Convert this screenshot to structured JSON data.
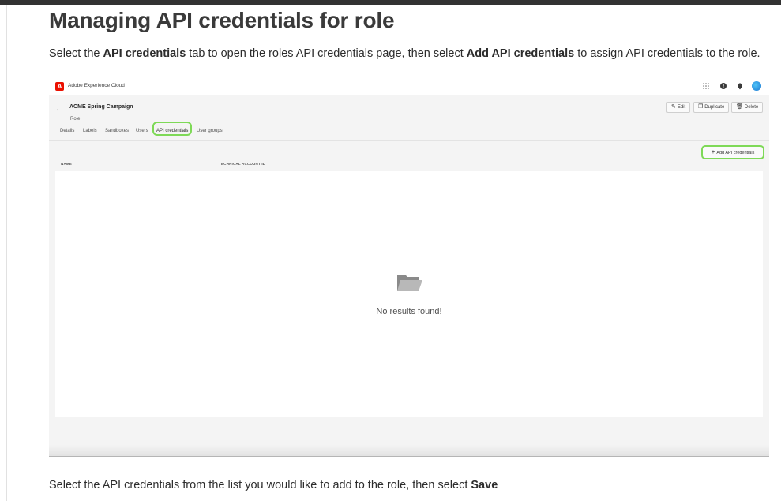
{
  "doc": {
    "title": "Managing API credentials for role",
    "para1": {
      "t1": "Select the ",
      "b1": "API credentials",
      "t2": " tab to open the roles API credentials page, then select ",
      "b2": "Add API credentials",
      "t3": " to assign API credentials to the role."
    },
    "para2": {
      "t1": "Select the API credentials from the list you would like to add to the role, then select ",
      "b1": "Save"
    }
  },
  "screenshot": {
    "brand": "Adobe Experience Cloud",
    "logo_letter": "A",
    "role_name": "ACME Spring Campaign",
    "role_type": "Role",
    "actions": {
      "edit": "Edit",
      "duplicate": "Duplicate",
      "delete": "Delete"
    },
    "tabs": [
      "Details",
      "Labels",
      "Sandboxes",
      "Users",
      "API credentials",
      "User groups"
    ],
    "selected_tab": "API credentials",
    "add_button": "Add API credentials",
    "columns": [
      "NAME",
      "TECHNICAL ACCOUNT ID"
    ],
    "empty_message": "No results found!",
    "colors": {
      "highlight": "#7ed957",
      "adobe_red": "#eb1000"
    },
    "icons": {
      "back": "arrow-left-icon",
      "apps": "apps-grid-icon",
      "help": "help-icon",
      "notifications": "bell-icon",
      "empty": "folder-icon"
    }
  }
}
